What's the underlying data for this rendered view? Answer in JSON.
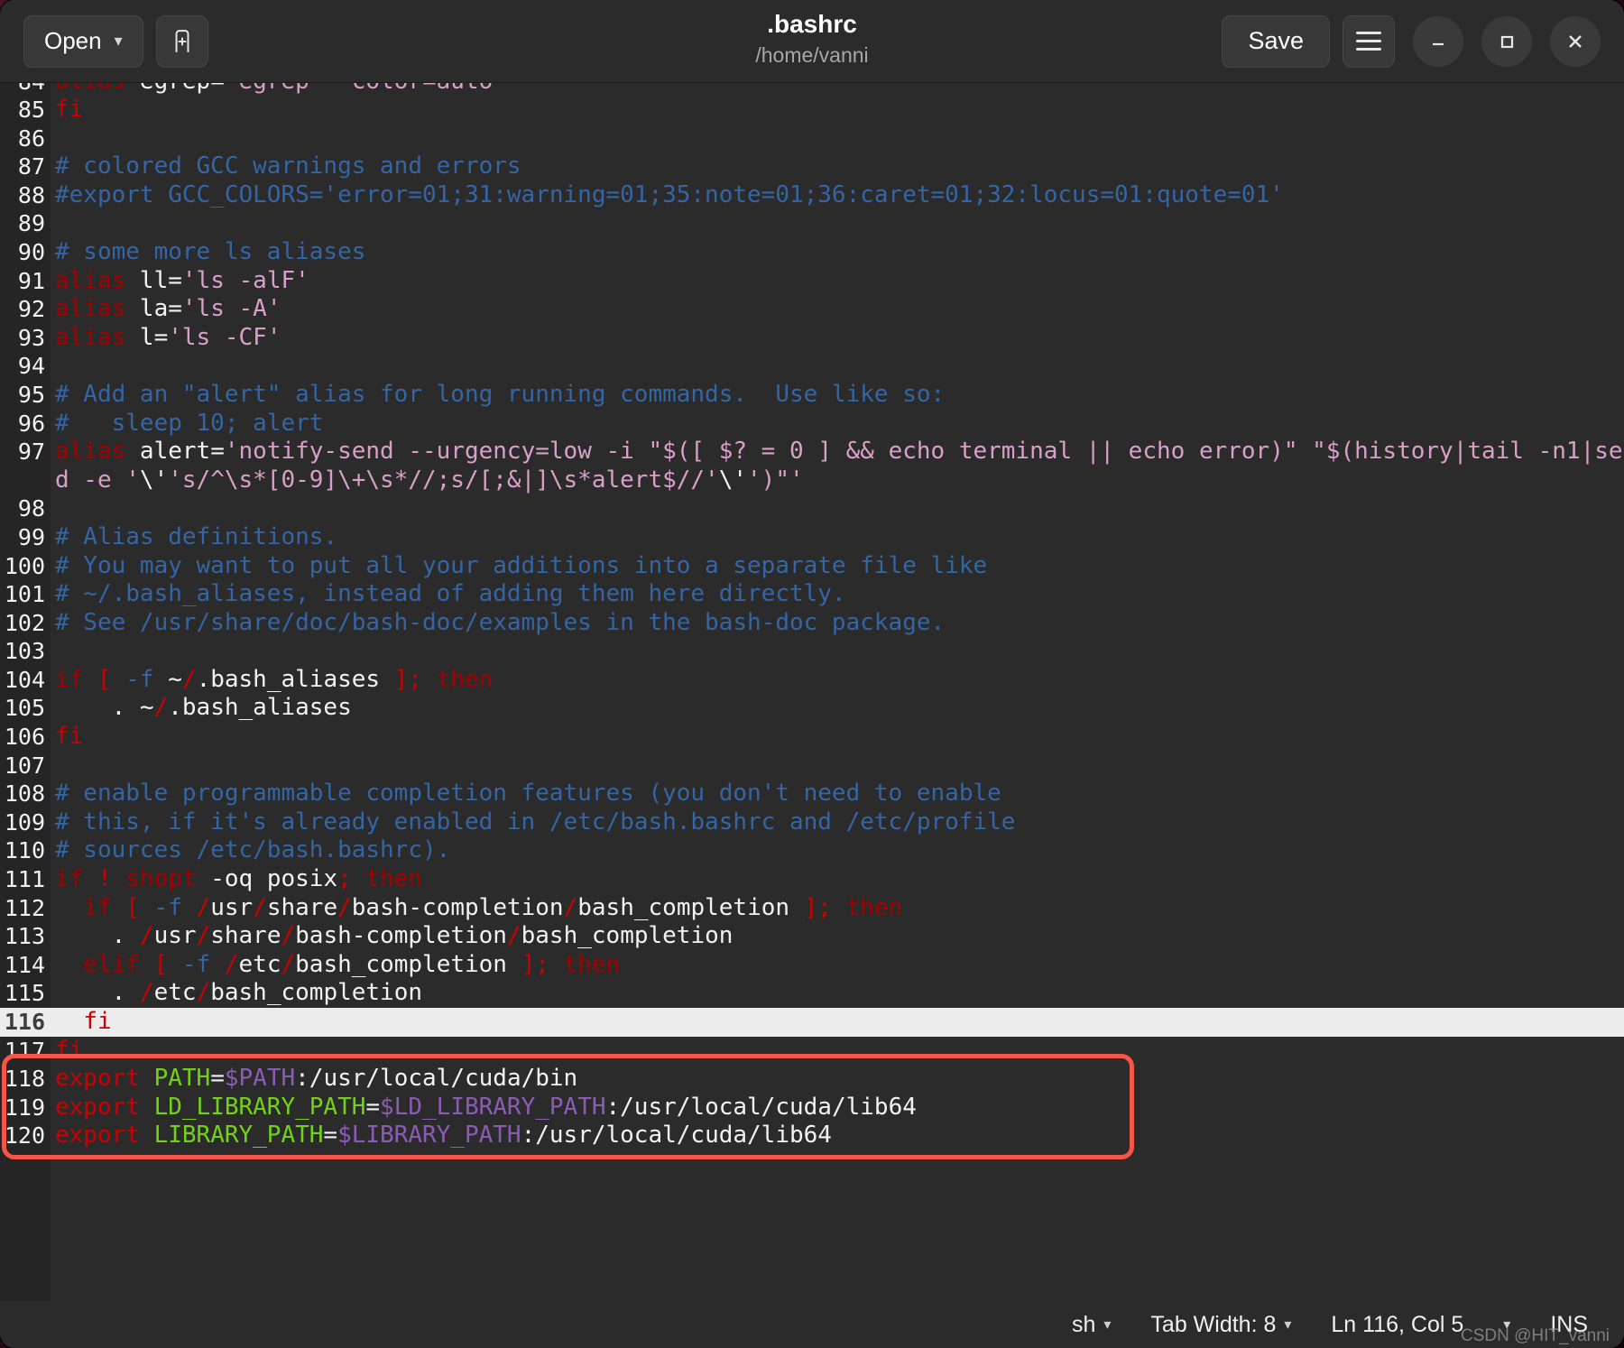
{
  "window": {
    "title": ".bashrc",
    "subtitle": "/home/vanni"
  },
  "header": {
    "open_label": "Open",
    "open_chevron": "chevron-down-icon",
    "new_document_icon": "new-document-icon",
    "save_label": "Save",
    "menu_icon": "hamburger-menu-icon",
    "minimize_icon": "minimize-icon",
    "maximize_icon": "maximize-icon",
    "close_icon": "close-icon"
  },
  "statusbar": {
    "language": "sh",
    "tab_width": "Tab Width: 8",
    "position": "Ln 116, Col 5",
    "insert_mode": "INS",
    "watermark": "CSDN @HIT_vanni"
  },
  "colors": {
    "window_bg": "#2b2b2b",
    "gutter_bg": "#252525",
    "comment": "#3465a4",
    "keyword": "#a40000",
    "string": "#d8a0c8",
    "variable_name": "#73d216",
    "variable_ref": "#8b5cb5",
    "current_line_bg": "#ececec",
    "annotation_box": "#f4564a"
  },
  "editor": {
    "cursor_line": 116,
    "lines": [
      {
        "n": 84,
        "partial_top": true,
        "tokens": [
          {
            "t": "alias ",
            "c": "c-kw"
          },
          {
            "t": "egrep=",
            "c": "c-txt"
          },
          {
            "t": "'egrep ",
            "c": "c-str"
          },
          {
            "t": "--color=auto'",
            "c": "c-str"
          }
        ]
      },
      {
        "n": 85,
        "tokens": [
          {
            "t": "fi",
            "c": "c-kw2"
          }
        ]
      },
      {
        "n": 86,
        "tokens": [
          {
            "t": "",
            "c": "c-txt"
          }
        ]
      },
      {
        "n": 87,
        "tokens": [
          {
            "t": "# colored GCC warnings and errors",
            "c": "c-com"
          }
        ]
      },
      {
        "n": 88,
        "tokens": [
          {
            "t": "#export GCC_COLORS='error=01;31:warning=01;35:note=01;36:caret=01;32:locus=01:quote=01'",
            "c": "c-com"
          }
        ]
      },
      {
        "n": 89,
        "tokens": [
          {
            "t": "",
            "c": "c-txt"
          }
        ]
      },
      {
        "n": 90,
        "tokens": [
          {
            "t": "# some more ls aliases",
            "c": "c-com"
          }
        ]
      },
      {
        "n": 91,
        "tokens": [
          {
            "t": "alias",
            "c": "c-kw"
          },
          {
            "t": " ll=",
            "c": "c-txt"
          },
          {
            "t": "'ls -alF'",
            "c": "c-str"
          }
        ]
      },
      {
        "n": 92,
        "tokens": [
          {
            "t": "alias",
            "c": "c-kw"
          },
          {
            "t": " la=",
            "c": "c-txt"
          },
          {
            "t": "'ls -A'",
            "c": "c-str"
          }
        ]
      },
      {
        "n": 93,
        "tokens": [
          {
            "t": "alias",
            "c": "c-kw"
          },
          {
            "t": " l=",
            "c": "c-txt"
          },
          {
            "t": "'ls -CF'",
            "c": "c-str"
          }
        ]
      },
      {
        "n": 94,
        "tokens": [
          {
            "t": "",
            "c": "c-txt"
          }
        ]
      },
      {
        "n": 95,
        "tokens": [
          {
            "t": "# Add an \"alert\" alias for long running commands.  Use like so:",
            "c": "c-com"
          }
        ]
      },
      {
        "n": 96,
        "tokens": [
          {
            "t": "#   sleep 10; alert",
            "c": "c-com"
          }
        ]
      },
      {
        "n": 97,
        "tokens": [
          {
            "t": "alias",
            "c": "c-kw"
          },
          {
            "t": " alert=",
            "c": "c-txt"
          },
          {
            "t": "'notify-send --urgency=low -i \"$([ $? = 0 ] && echo terminal || echo error)\" \"$(history|tail -n1|sed -e '",
            "c": "c-str"
          },
          {
            "t": "\\'",
            "c": "c-txt"
          },
          {
            "t": "'s/^\\s*[0-9]\\+\\s*//;s/[;&|]\\s*alert$//'",
            "c": "c-str"
          },
          {
            "t": "\\'",
            "c": "c-txt"
          },
          {
            "t": "')\"'",
            "c": "c-str"
          }
        ]
      },
      {
        "n": 98,
        "tokens": [
          {
            "t": "",
            "c": "c-txt"
          }
        ]
      },
      {
        "n": 99,
        "tokens": [
          {
            "t": "# Alias definitions.",
            "c": "c-com"
          }
        ]
      },
      {
        "n": 100,
        "tokens": [
          {
            "t": "# You may want to put all your additions into a separate file like",
            "c": "c-com"
          }
        ]
      },
      {
        "n": 101,
        "tokens": [
          {
            "t": "# ~/.bash_aliases, instead of adding them here directly.",
            "c": "c-com"
          }
        ]
      },
      {
        "n": 102,
        "tokens": [
          {
            "t": "# See /usr/share/doc/bash-doc/examples in the bash-doc package.",
            "c": "c-com"
          }
        ]
      },
      {
        "n": 103,
        "tokens": [
          {
            "t": "",
            "c": "c-txt"
          }
        ]
      },
      {
        "n": 104,
        "tokens": [
          {
            "t": "if",
            "c": "c-kw"
          },
          {
            "t": " ",
            "c": "c-txt"
          },
          {
            "t": "[",
            "c": "c-punc"
          },
          {
            "t": " ",
            "c": "c-txt"
          },
          {
            "t": "-f",
            "c": "c-opt"
          },
          {
            "t": " ~",
            "c": "c-txt"
          },
          {
            "t": "/",
            "c": "c-slash"
          },
          {
            "t": ".bash_aliases ",
            "c": "c-txt"
          },
          {
            "t": "];",
            "c": "c-punc"
          },
          {
            "t": " ",
            "c": "c-txt"
          },
          {
            "t": "then",
            "c": "c-kw"
          }
        ]
      },
      {
        "n": 105,
        "tokens": [
          {
            "t": "    . ~",
            "c": "c-txt"
          },
          {
            "t": "/",
            "c": "c-slash"
          },
          {
            "t": ".bash_aliases",
            "c": "c-txt"
          }
        ]
      },
      {
        "n": 106,
        "tokens": [
          {
            "t": "fi",
            "c": "c-kw2"
          }
        ]
      },
      {
        "n": 107,
        "tokens": [
          {
            "t": "",
            "c": "c-txt"
          }
        ]
      },
      {
        "n": 108,
        "tokens": [
          {
            "t": "# enable programmable completion features (you don't need to enable",
            "c": "c-com"
          }
        ]
      },
      {
        "n": 109,
        "tokens": [
          {
            "t": "# this, if it's already enabled in /etc/bash.bashrc and /etc/profile",
            "c": "c-com"
          }
        ]
      },
      {
        "n": 110,
        "tokens": [
          {
            "t": "# sources /etc/bash.bashrc).",
            "c": "c-com"
          }
        ]
      },
      {
        "n": 111,
        "tokens": [
          {
            "t": "if",
            "c": "c-kw"
          },
          {
            "t": " ",
            "c": "c-txt"
          },
          {
            "t": "!",
            "c": "c-punc"
          },
          {
            "t": " ",
            "c": "c-txt"
          },
          {
            "t": "shopt",
            "c": "c-kw"
          },
          {
            "t": " -oq posix",
            "c": "c-txt"
          },
          {
            "t": ";",
            "c": "c-punc"
          },
          {
            "t": " ",
            "c": "c-txt"
          },
          {
            "t": "then",
            "c": "c-kw"
          }
        ]
      },
      {
        "n": 112,
        "tokens": [
          {
            "t": "  ",
            "c": "c-txt"
          },
          {
            "t": "if",
            "c": "c-kw"
          },
          {
            "t": " ",
            "c": "c-txt"
          },
          {
            "t": "[",
            "c": "c-punc"
          },
          {
            "t": " ",
            "c": "c-txt"
          },
          {
            "t": "-f",
            "c": "c-opt"
          },
          {
            "t": " ",
            "c": "c-txt"
          },
          {
            "t": "/",
            "c": "c-slash"
          },
          {
            "t": "usr",
            "c": "c-txt"
          },
          {
            "t": "/",
            "c": "c-slash"
          },
          {
            "t": "share",
            "c": "c-txt"
          },
          {
            "t": "/",
            "c": "c-slash"
          },
          {
            "t": "bash-completion",
            "c": "c-txt"
          },
          {
            "t": "/",
            "c": "c-slash"
          },
          {
            "t": "bash_completion ",
            "c": "c-txt"
          },
          {
            "t": "];",
            "c": "c-punc"
          },
          {
            "t": " ",
            "c": "c-txt"
          },
          {
            "t": "then",
            "c": "c-kw"
          }
        ]
      },
      {
        "n": 113,
        "tokens": [
          {
            "t": "    . ",
            "c": "c-txt"
          },
          {
            "t": "/",
            "c": "c-slash"
          },
          {
            "t": "usr",
            "c": "c-txt"
          },
          {
            "t": "/",
            "c": "c-slash"
          },
          {
            "t": "share",
            "c": "c-txt"
          },
          {
            "t": "/",
            "c": "c-slash"
          },
          {
            "t": "bash-completion",
            "c": "c-txt"
          },
          {
            "t": "/",
            "c": "c-slash"
          },
          {
            "t": "bash_completion",
            "c": "c-txt"
          }
        ]
      },
      {
        "n": 114,
        "tokens": [
          {
            "t": "  ",
            "c": "c-txt"
          },
          {
            "t": "elif",
            "c": "c-kw"
          },
          {
            "t": " ",
            "c": "c-txt"
          },
          {
            "t": "[",
            "c": "c-punc"
          },
          {
            "t": " ",
            "c": "c-txt"
          },
          {
            "t": "-f",
            "c": "c-opt"
          },
          {
            "t": " ",
            "c": "c-txt"
          },
          {
            "t": "/",
            "c": "c-slash"
          },
          {
            "t": "etc",
            "c": "c-txt"
          },
          {
            "t": "/",
            "c": "c-slash"
          },
          {
            "t": "bash_completion ",
            "c": "c-txt"
          },
          {
            "t": "];",
            "c": "c-punc"
          },
          {
            "t": " ",
            "c": "c-txt"
          },
          {
            "t": "then",
            "c": "c-kw"
          }
        ]
      },
      {
        "n": 115,
        "tokens": [
          {
            "t": "    . ",
            "c": "c-txt"
          },
          {
            "t": "/",
            "c": "c-slash"
          },
          {
            "t": "etc",
            "c": "c-txt"
          },
          {
            "t": "/",
            "c": "c-slash"
          },
          {
            "t": "bash_completion",
            "c": "c-txt"
          }
        ]
      },
      {
        "n": 116,
        "current": true,
        "tokens": [
          {
            "t": "  ",
            "c": "c-txt"
          },
          {
            "t": "fi",
            "c": "c-kw2"
          }
        ]
      },
      {
        "n": 117,
        "tokens": [
          {
            "t": "fi",
            "c": "c-kw2"
          }
        ]
      },
      {
        "n": 118,
        "tokens": [
          {
            "t": "export",
            "c": "c-kw2"
          },
          {
            "t": " ",
            "c": "c-txt"
          },
          {
            "t": "PATH",
            "c": "c-var"
          },
          {
            "t": "=",
            "c": "c-txt"
          },
          {
            "t": "$PATH",
            "c": "c-dollar"
          },
          {
            "t": ":/usr/local/cuda/bin",
            "c": "c-txt"
          }
        ]
      },
      {
        "n": 119,
        "tokens": [
          {
            "t": "export",
            "c": "c-kw2"
          },
          {
            "t": " ",
            "c": "c-txt"
          },
          {
            "t": "LD_LIBRARY_PATH",
            "c": "c-var"
          },
          {
            "t": "=",
            "c": "c-txt"
          },
          {
            "t": "$LD_LIBRARY_PATH",
            "c": "c-dollar"
          },
          {
            "t": ":/usr/local/cuda/lib64",
            "c": "c-txt"
          }
        ]
      },
      {
        "n": 120,
        "tokens": [
          {
            "t": "export",
            "c": "c-kw2"
          },
          {
            "t": " ",
            "c": "c-txt"
          },
          {
            "t": "LIBRARY_PATH",
            "c": "c-var"
          },
          {
            "t": "=",
            "c": "c-txt"
          },
          {
            "t": "$LIBRARY_PATH",
            "c": "c-dollar"
          },
          {
            "t": ":/usr/local/cuda/lib64",
            "c": "c-txt"
          }
        ]
      }
    ]
  }
}
